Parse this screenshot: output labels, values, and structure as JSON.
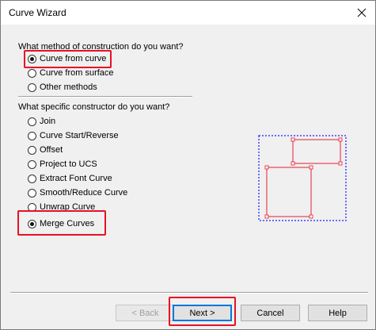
{
  "window": {
    "title": "Curve Wizard",
    "close_icon": "close-icon"
  },
  "method": {
    "question": "What method of construction do you want?",
    "options": [
      {
        "label": "Curve from curve",
        "checked": true
      },
      {
        "label": "Curve from surface",
        "checked": false
      },
      {
        "label": "Other methods",
        "checked": false
      }
    ]
  },
  "constructor": {
    "question": "What specific constructor do you want?",
    "options": [
      {
        "label": "Join",
        "checked": false
      },
      {
        "label": "Curve Start/Reverse",
        "checked": false
      },
      {
        "label": "Offset",
        "checked": false
      },
      {
        "label": "Project to UCS",
        "checked": false
      },
      {
        "label": "Extract Font Curve",
        "checked": false
      },
      {
        "label": "Smooth/Reduce Curve",
        "checked": false
      },
      {
        "label": "Unwrap Curve",
        "checked": false
      },
      {
        "label": "Merge Curves",
        "checked": true
      }
    ]
  },
  "buttons": {
    "back": "< Back",
    "next": "Next >",
    "cancel": "Cancel",
    "help": "Help"
  },
  "colors": {
    "highlight": "#e81123",
    "preview_bbox": "#4040ff",
    "preview_curve": "#e8414f",
    "default_button": "#0078d7"
  }
}
